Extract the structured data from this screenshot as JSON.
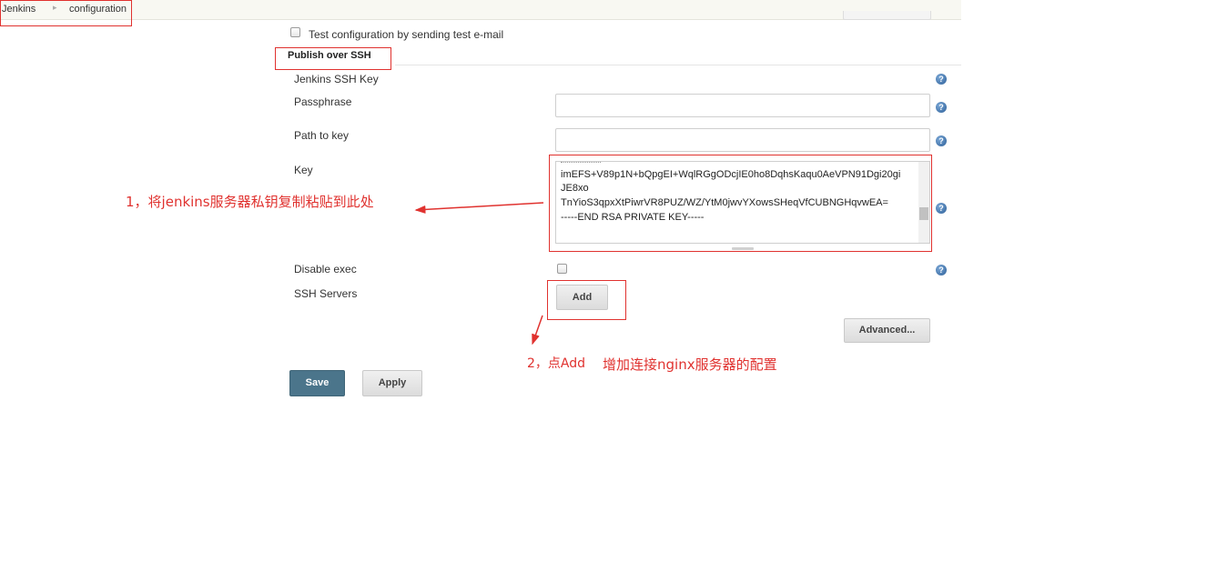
{
  "breadcrumb": {
    "items": [
      "Jenkins",
      "configuration"
    ],
    "separator": "▸"
  },
  "email_test": {
    "label": "Test configuration by sending test e-mail",
    "checked": false
  },
  "section": {
    "title": "Publish over SSH"
  },
  "fields": {
    "jenkins_ssh_key_label": "Jenkins SSH Key",
    "passphrase_label": "Passphrase",
    "passphrase_value": "",
    "path_to_key_label": "Path to key",
    "path_to_key_value": "",
    "key_label": "Key",
    "key_lines": [
      "imEFS+V89p1N+bQpgEI+WqlRGgODcjIE0ho8DqhsKaqu0AeVPN91Dgi20gi",
      "JE8xo",
      "TnYioS3qpxXtPiwrVR8PUZ/WZ/YtM0jwvYXowsSHeqVfCUBNGHqvwEA=",
      "-----END RSA PRIVATE KEY-----"
    ],
    "disable_exec_label": "Disable exec",
    "disable_exec_checked": false,
    "ssh_servers_label": "SSH Servers"
  },
  "buttons": {
    "add": "Add",
    "advanced": "Advanced...",
    "save": "Save",
    "apply": "Apply"
  },
  "help_icon_glyph": "?",
  "annotations": {
    "step1": "1，将jenkins服务器私钥复制粘贴到此处",
    "step2": "2，点Add",
    "step2_note": "增加连接nginx服务器的配置"
  },
  "colors": {
    "annotation_red": "#e0322f",
    "save_button": "#4b758b",
    "help_icon": "#2c5f98"
  }
}
